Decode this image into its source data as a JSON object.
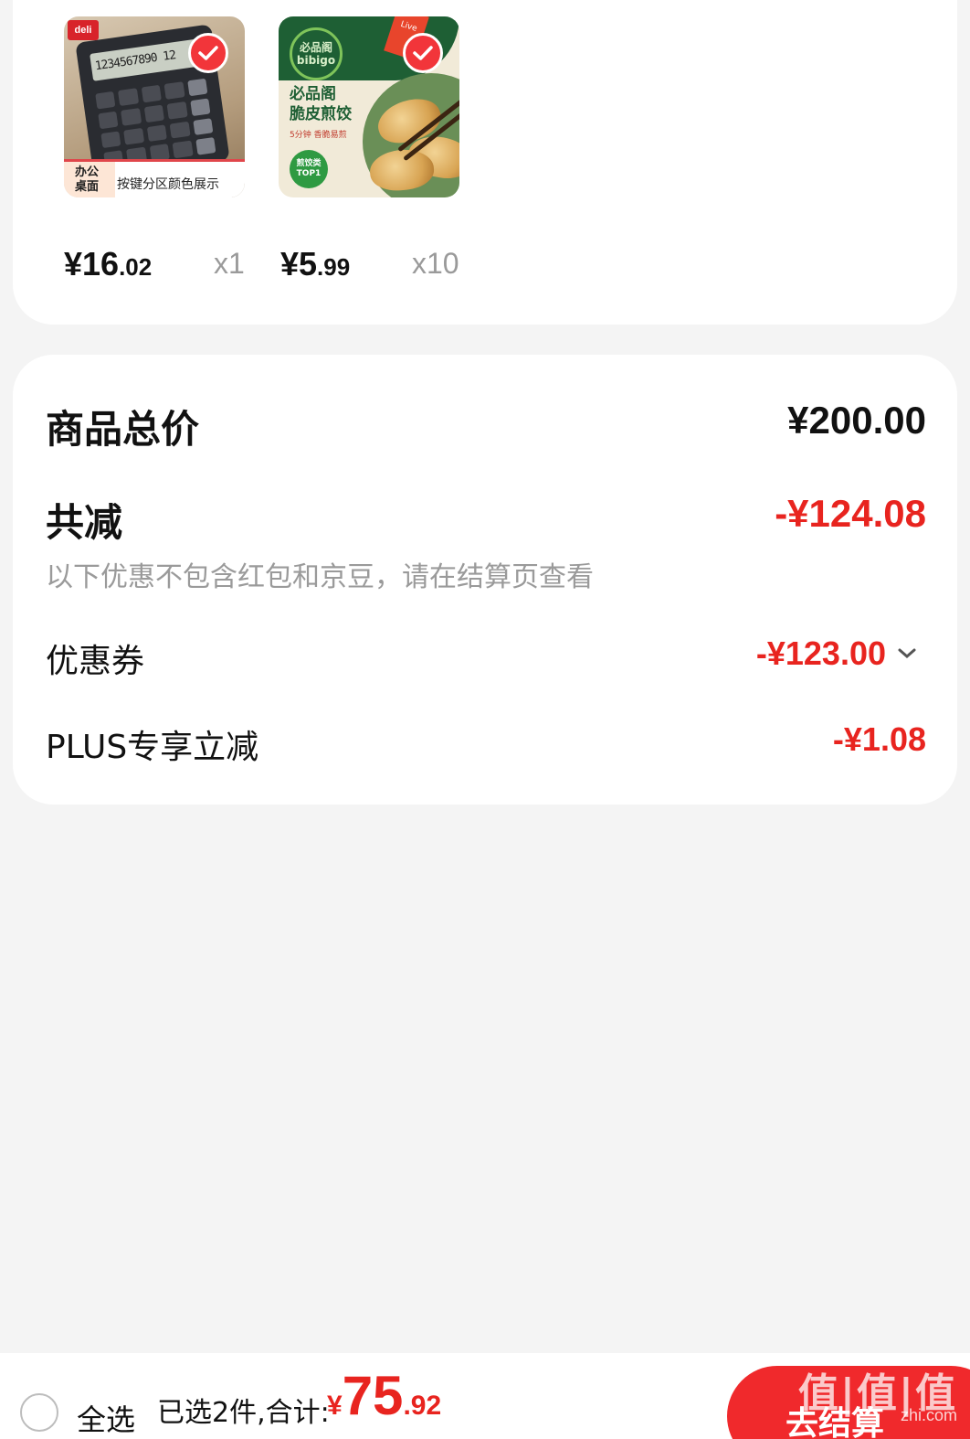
{
  "products": [
    {
      "name": "calculator",
      "price_int": "¥16",
      "price_dec": ".02",
      "qty": "x1",
      "selected": true,
      "thumb": {
        "brand": "deli",
        "screen": "1234567890 12",
        "banner_left": "办公\n桌面",
        "banner_right": "按键分区颜色展示"
      }
    },
    {
      "name": "dumplings",
      "price_int": "¥5",
      "price_dec": ".99",
      "qty": "x10",
      "selected": true,
      "thumb": {
        "logo": "必品阁\nbibigo",
        "title": "必品阁\n脆皮煎饺",
        "sub": "5分钟 香脆易煎",
        "award": "煎饺类\nTOP1",
        "live": "Live"
      }
    }
  ],
  "summary": {
    "total_label": "商品总价",
    "total_value": "¥200.00",
    "reduce_label": "共减",
    "reduce_value": "-¥124.08",
    "note": "以下优惠不包含红包和京豆，请在结算页查看",
    "coupon_label": "优惠券",
    "coupon_value": "-¥123.00",
    "plus_label": "PLUS专享立减",
    "plus_value": "-¥1.08"
  },
  "bottom_bar": {
    "select_all_label": "全选",
    "summary_text": "已选2件,合计:",
    "price_symbol": "¥",
    "price_int": "75",
    "price_dec": ".92",
    "checkout_label": "去结算",
    "watermark": "值|值|值",
    "watermark_sub": "zhi.com"
  },
  "colors": {
    "accent": "#e8241f",
    "checkout": "#f0292c",
    "background": "#f4f4f4"
  }
}
